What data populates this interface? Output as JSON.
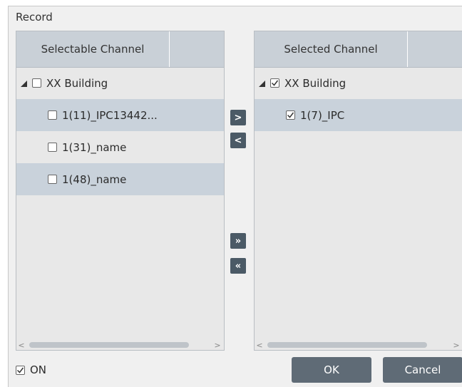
{
  "dialog": {
    "title": "Record"
  },
  "left_panel": {
    "header": "Selectable Channel",
    "parent": {
      "label": "XX Building",
      "checked": false
    },
    "items": [
      {
        "label": "1(11)_IPC13442...",
        "checked": false
      },
      {
        "label": "1(31)_name",
        "checked": false
      },
      {
        "label": "1(48)_name",
        "checked": false
      }
    ]
  },
  "right_panel": {
    "header": "Selected Channel",
    "parent": {
      "label": "XX Building",
      "checked": true
    },
    "items": [
      {
        "label": "1(7)_IPC",
        "checked": true
      }
    ]
  },
  "move_buttons": {
    "add": ">",
    "remove": "<",
    "add_all": "»",
    "remove_all": "«"
  },
  "scroll": {
    "left_arrow": "<",
    "right_arrow": ">"
  },
  "footer": {
    "on_label": "ON",
    "on_checked": true,
    "ok_label": "OK",
    "cancel_label": "Cancel"
  },
  "colors": {
    "header_bg": "#c9d0d7",
    "alt_row_bg": "#c9d2db",
    "button_bg": "#5f6b76",
    "move_button_bg": "#4b5a66"
  }
}
